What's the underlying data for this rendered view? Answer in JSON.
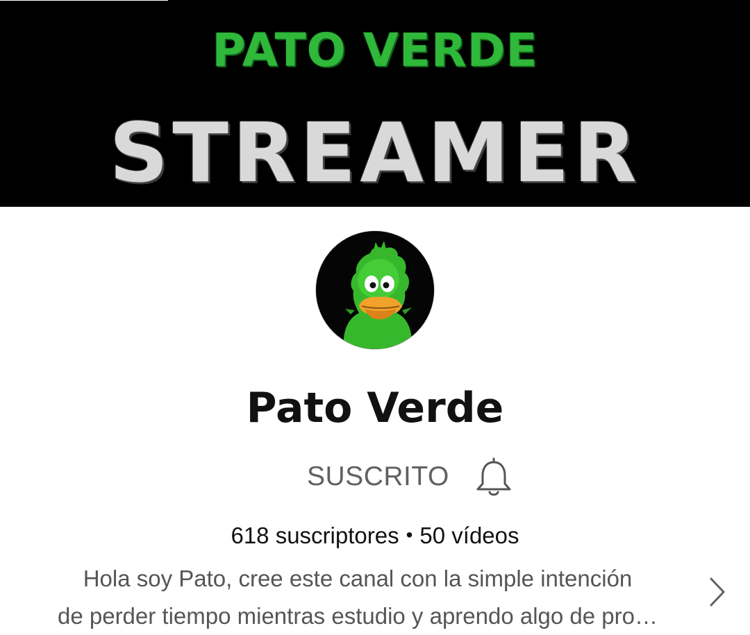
{
  "banner": {
    "title": "PATO VERDE",
    "subtitle": "STREAMER",
    "title_color": "#2fb83a",
    "subtitle_color": "#d9d9d9"
  },
  "channel": {
    "avatar_icon": "green-duck-avatar",
    "name": "Pato Verde",
    "subscribe_label": "SUSCRITO",
    "bell_icon": "bell-icon",
    "subscribers": "618 suscriptores",
    "separator": "•",
    "videos": "50 vídeos",
    "description_line1": "Hola soy Pato, cree este canal con la simple intención",
    "description_line2": "de perder tiempo mientras estudio y aprendo algo de pro…",
    "expand_icon": "chevron-right-icon"
  }
}
